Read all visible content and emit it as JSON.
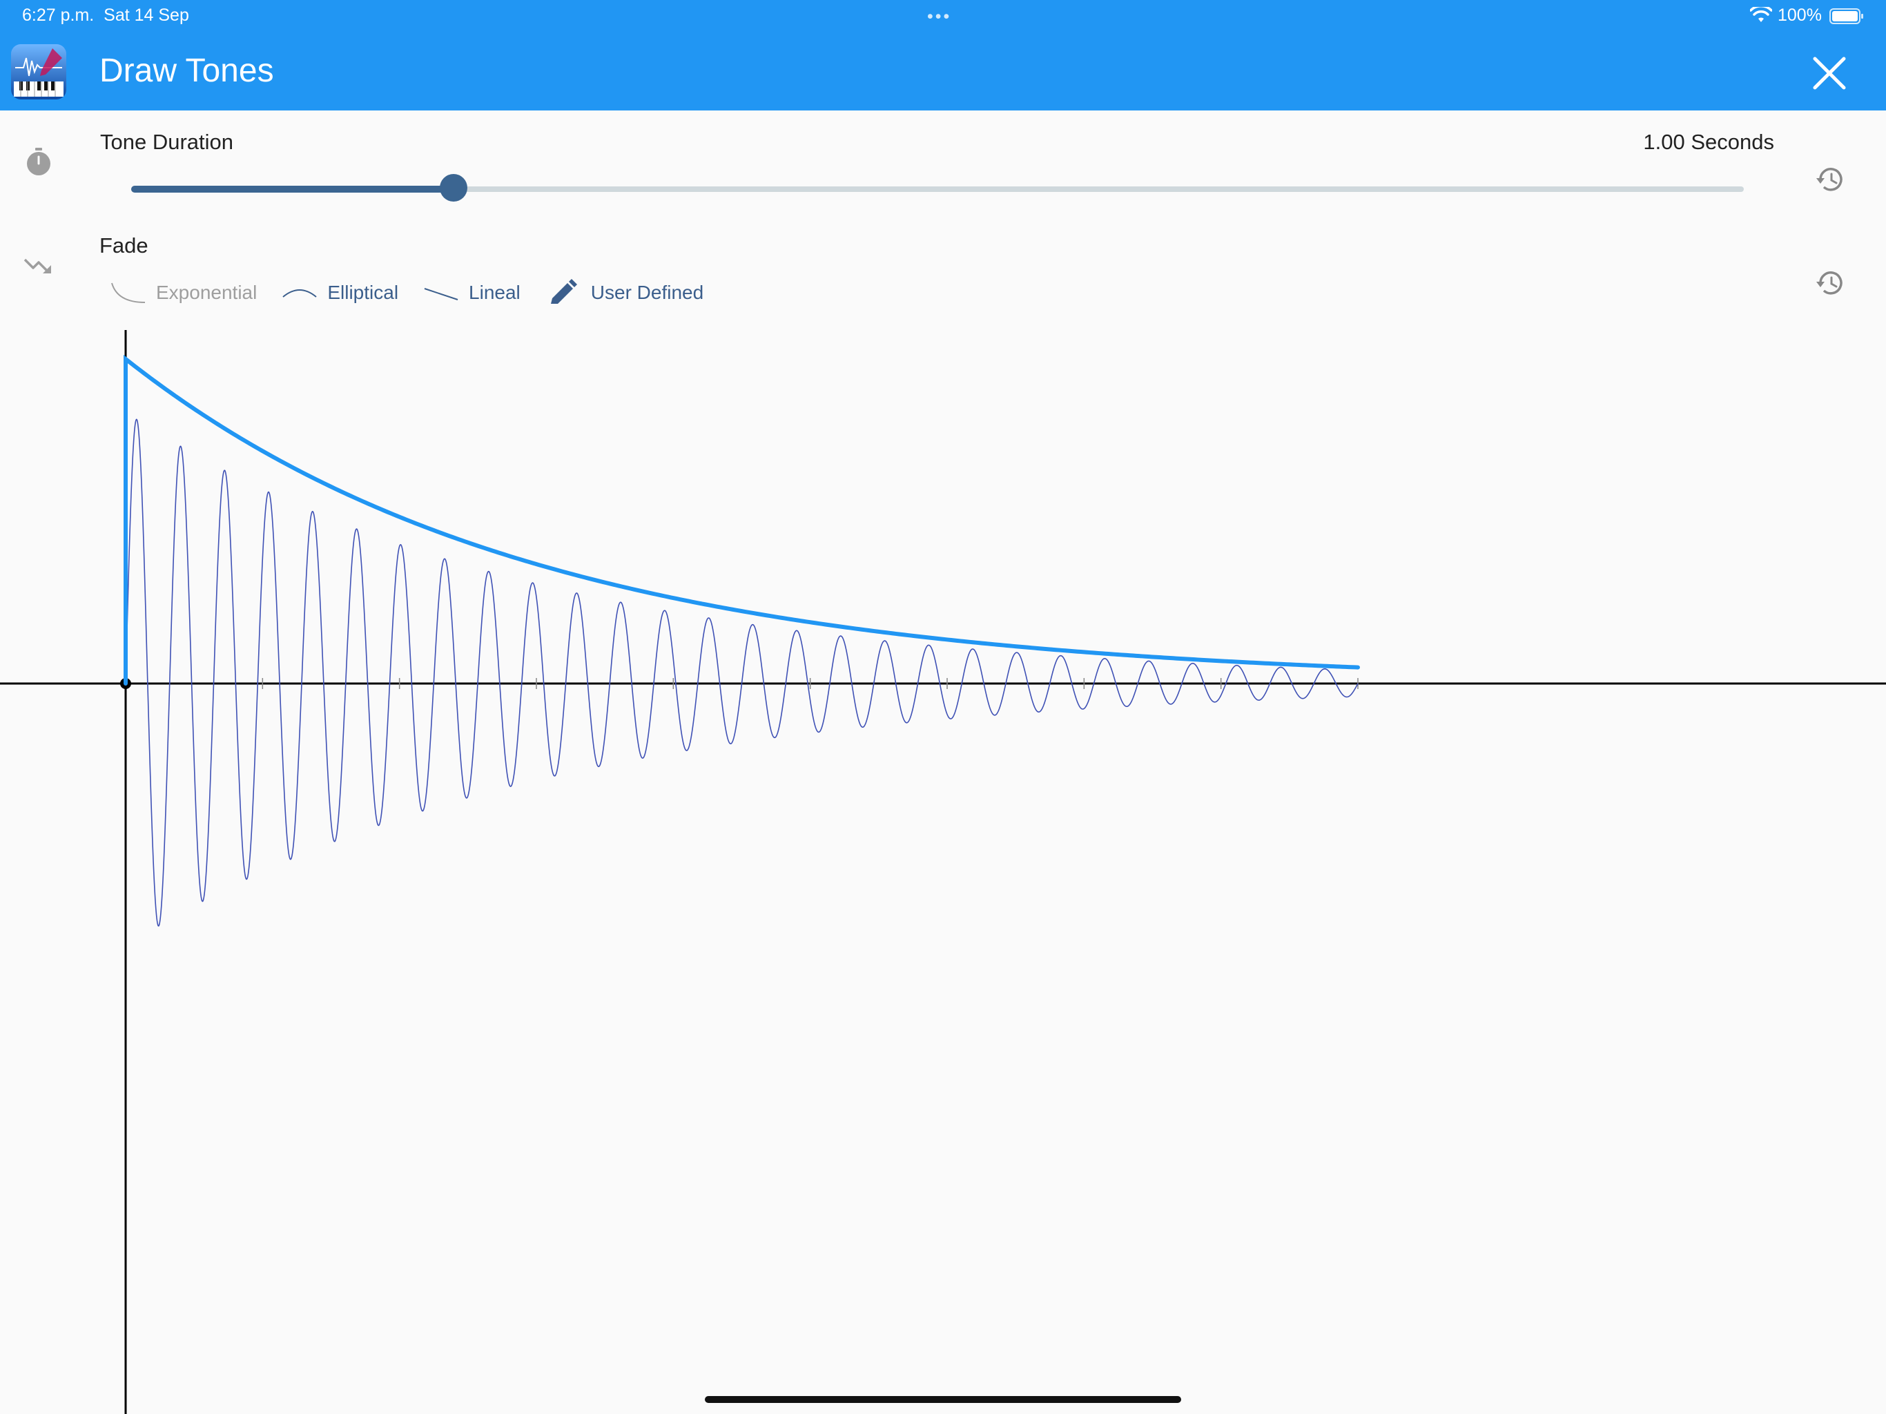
{
  "status_bar": {
    "time": "6:27 p.m.",
    "date": "Sat 14 Sep",
    "dots": "•••",
    "battery": "100%"
  },
  "header": {
    "title": "Draw Tones",
    "bg_color": "#2196f3"
  },
  "duration": {
    "label": "Tone Duration",
    "value_text": "1.00 Seconds",
    "slider_fraction": 0.2
  },
  "fade": {
    "label": "Fade",
    "options": [
      {
        "label": "Exponential",
        "enabled": false
      },
      {
        "label": "Elliptical",
        "enabled": true
      },
      {
        "label": "Lineal",
        "enabled": true
      },
      {
        "label": "User Defined",
        "enabled": true
      }
    ]
  },
  "icons": {
    "duration": "stopwatch-icon",
    "fade": "trending-down-icon",
    "reset": "history-icon",
    "close": "close-icon",
    "user_defined": "pencil-icon"
  },
  "chart_data": {
    "type": "line",
    "series": [
      {
        "kind": "envelope",
        "color": "#2196f3",
        "x": [
          0,
          0.1,
          0.2,
          0.3,
          0.4,
          0.5,
          0.6,
          0.7,
          0.8,
          0.9,
          1.0
        ],
        "y": [
          1.0,
          0.741,
          0.549,
          0.407,
          0.301,
          0.223,
          0.165,
          0.122,
          0.091,
          0.067,
          0.05
        ]
      },
      {
        "kind": "waveform",
        "color": "#3f51b5",
        "cycles": 28,
        "decay": 3.0
      }
    ],
    "x_range": [
      0,
      1.0
    ],
    "y_range": [
      -3.0,
      1.0
    ],
    "grid": false
  }
}
